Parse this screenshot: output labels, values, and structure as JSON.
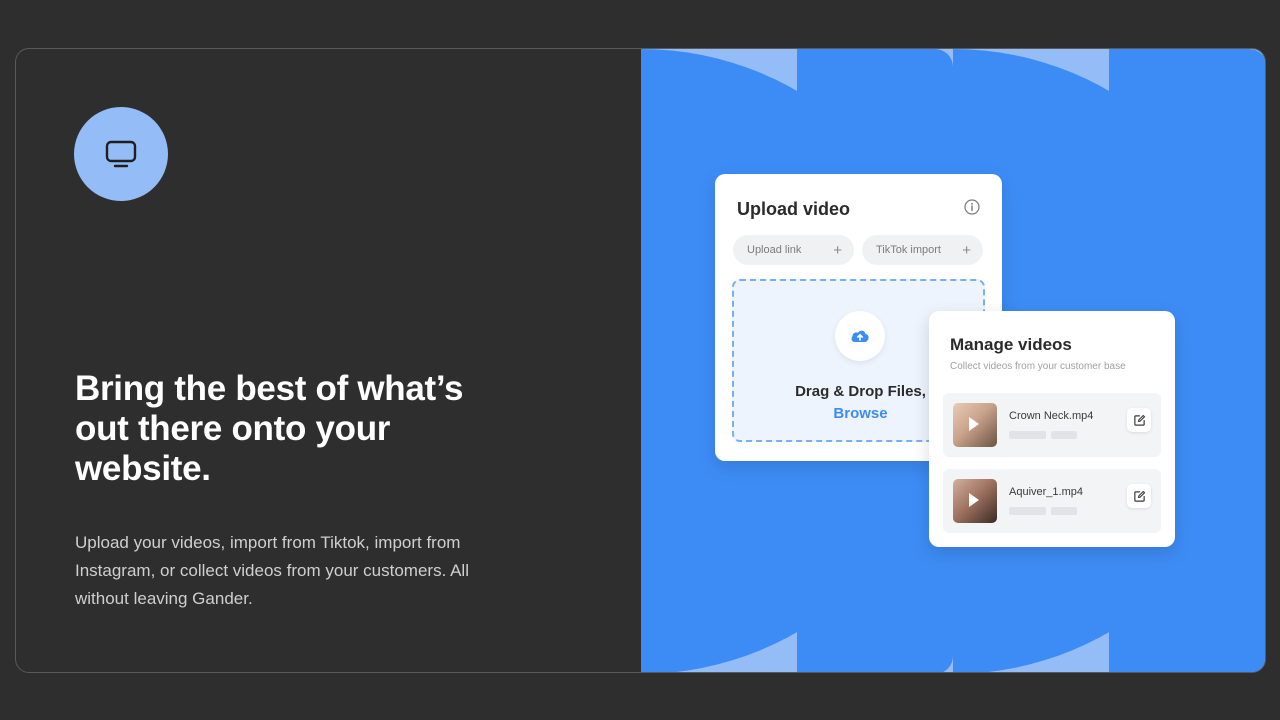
{
  "hero": {
    "headline": "Bring the best of what’s out there onto your website.",
    "description": "Upload your videos, import from Tiktok, import from Instagram, or collect videos from your customers. All without leaving Gander.",
    "icon": "monitor-icon"
  },
  "upload_card": {
    "title": "Upload video",
    "upload_link_label": "Upload link",
    "tiktok_import_label": "TikTok import",
    "plus_glyph": "+",
    "drag_text": "Drag & Drop Files,",
    "browse_text": "Browse"
  },
  "manage_card": {
    "title": "Manage videos",
    "subtitle": "Collect videos from your customer base",
    "videos": [
      {
        "name": "Crown Neck.mp4"
      },
      {
        "name": "Aquiver_1.mp4"
      }
    ]
  },
  "colors": {
    "background": "#2e2e2e",
    "accent_light": "#94bcf7",
    "accent_blue": "#3d8cf5"
  }
}
